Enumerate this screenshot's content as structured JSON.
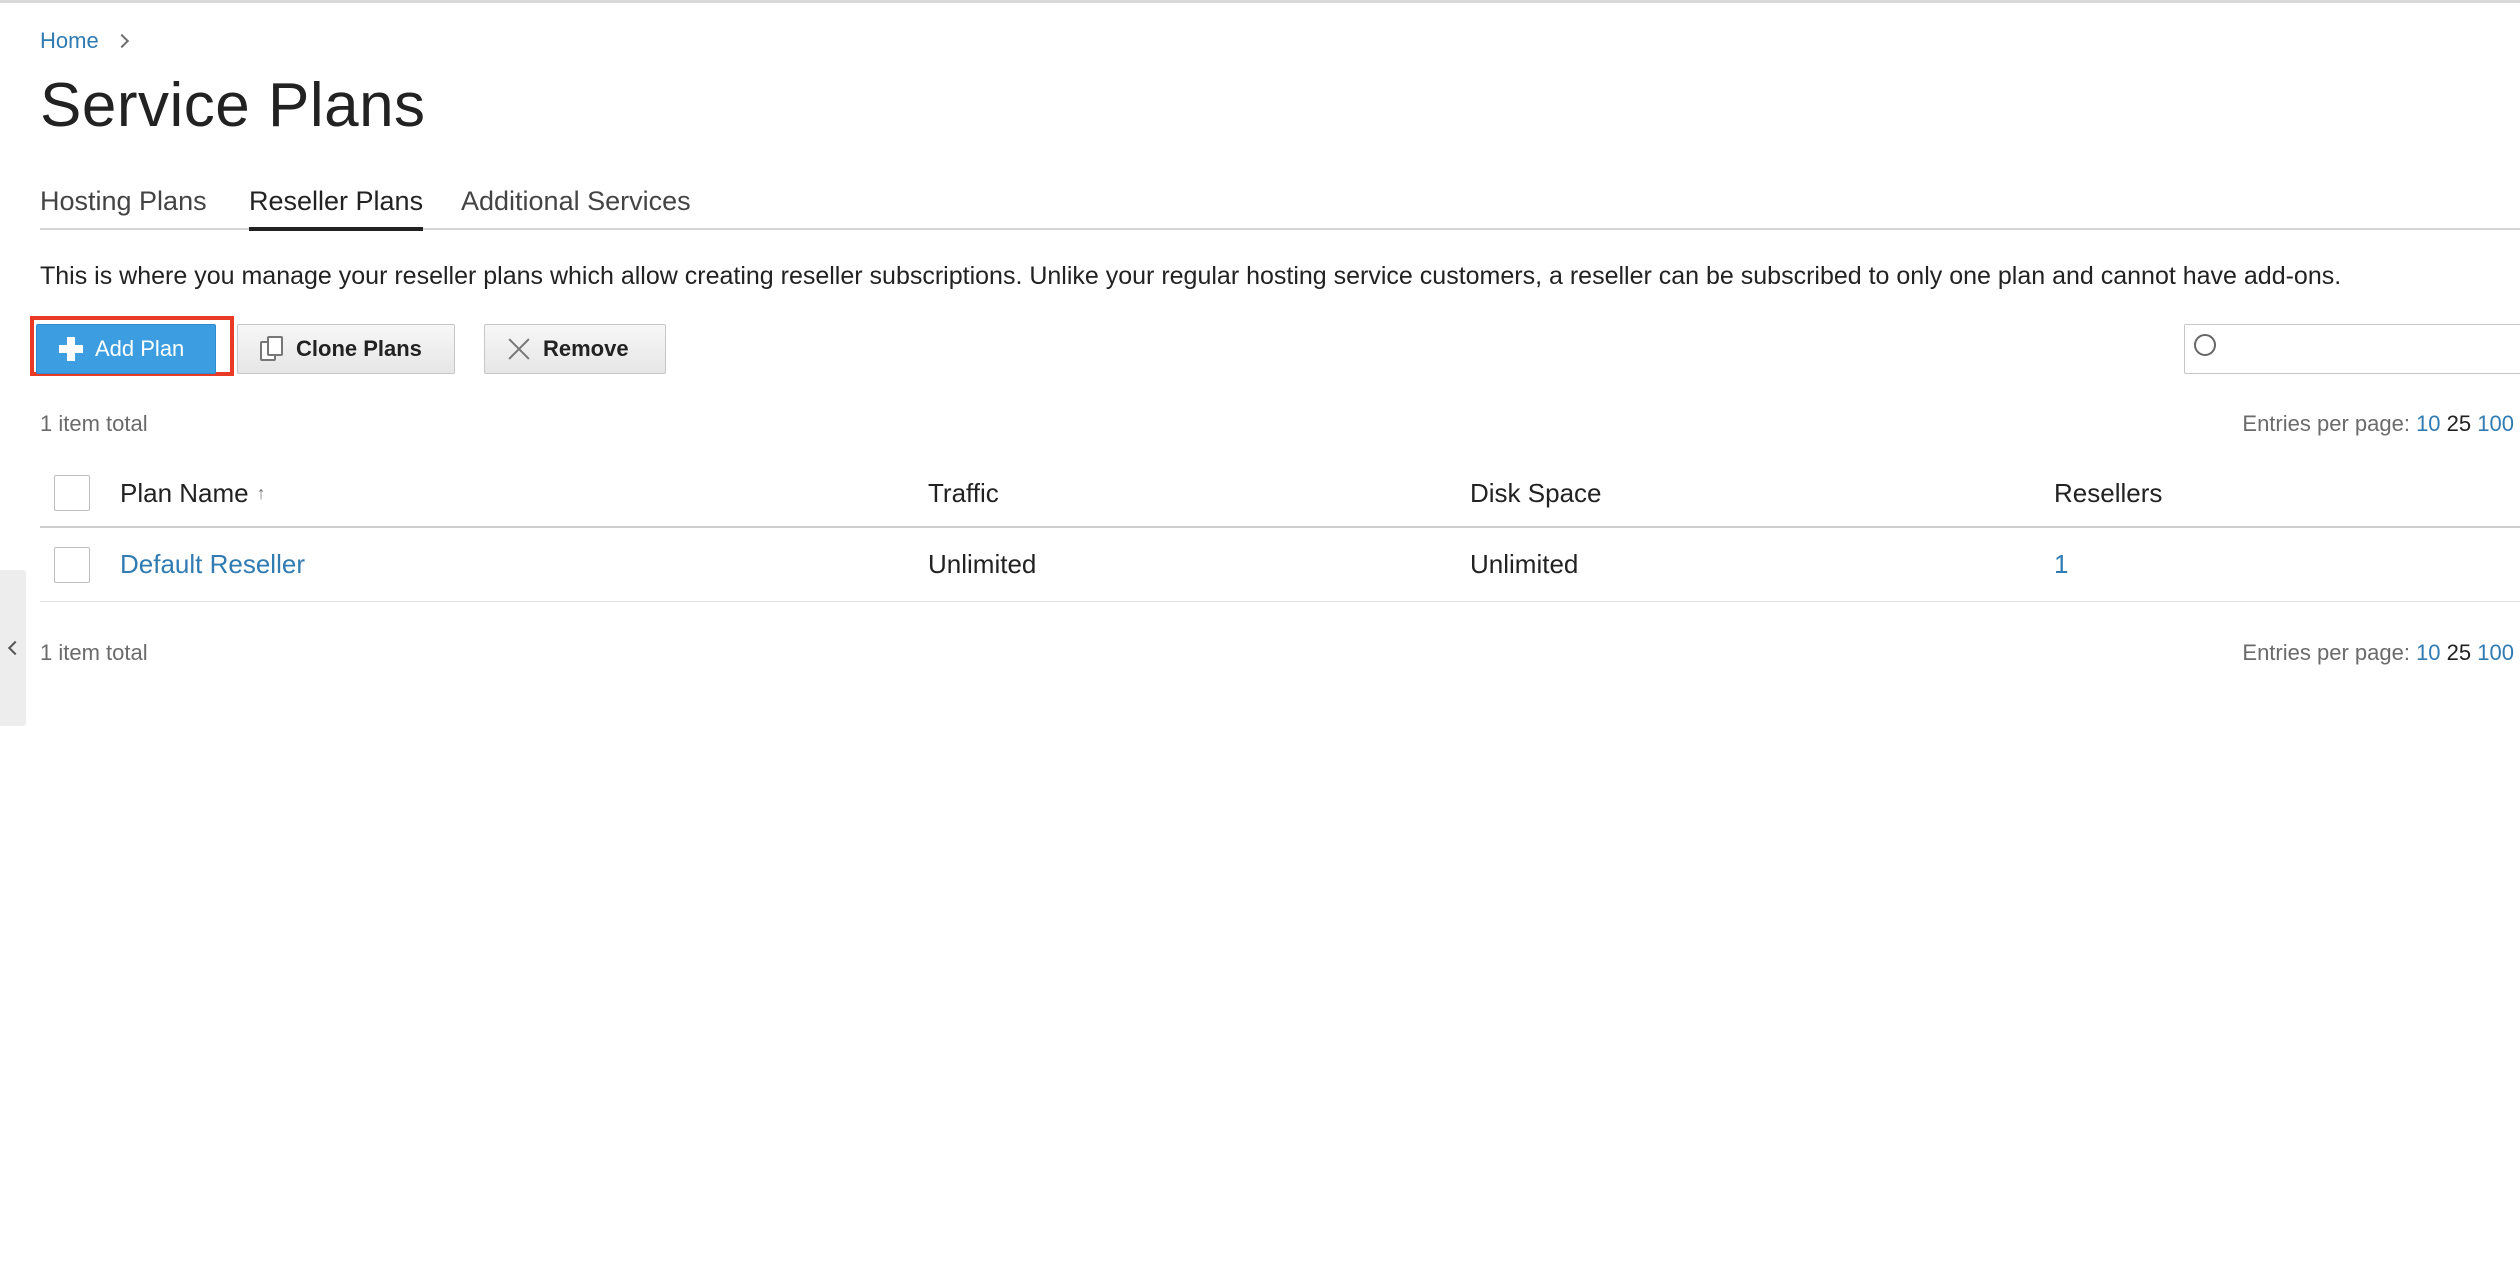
{
  "breadcrumb": {
    "home": "Home"
  },
  "page_title": "Service Plans",
  "tabs": [
    {
      "label": "Hosting Plans",
      "active": false
    },
    {
      "label": "Reseller Plans",
      "active": true
    },
    {
      "label": "Additional Services",
      "active": false
    }
  ],
  "description": "This is where you manage your reseller plans which allow creating reseller subscriptions. Unlike your regular hosting service customers, a reseller can be subscribed to only one plan and cannot have add-ons.",
  "toolbar": {
    "add_label": "Add Plan",
    "clone_label": "Clone Plans",
    "remove_label": "Remove",
    "search_placeholder": ""
  },
  "list": {
    "total_top": "1 item total",
    "total_bottom": "1 item total",
    "entries_label": "Entries per page:",
    "entries_options": [
      "10",
      "25",
      "100"
    ],
    "entries_selected": "25",
    "columns": {
      "name": "Plan Name",
      "traffic": "Traffic",
      "disk": "Disk Space",
      "resellers": "Resellers"
    },
    "sort_indicator": "↑",
    "rows": [
      {
        "name": "Default Reseller",
        "traffic": "Unlimited",
        "disk": "Unlimited",
        "resellers": "1"
      }
    ]
  },
  "colors": {
    "accent": "#3c9ee0",
    "link": "#2f7bb2",
    "highlight": "#e83a24"
  }
}
